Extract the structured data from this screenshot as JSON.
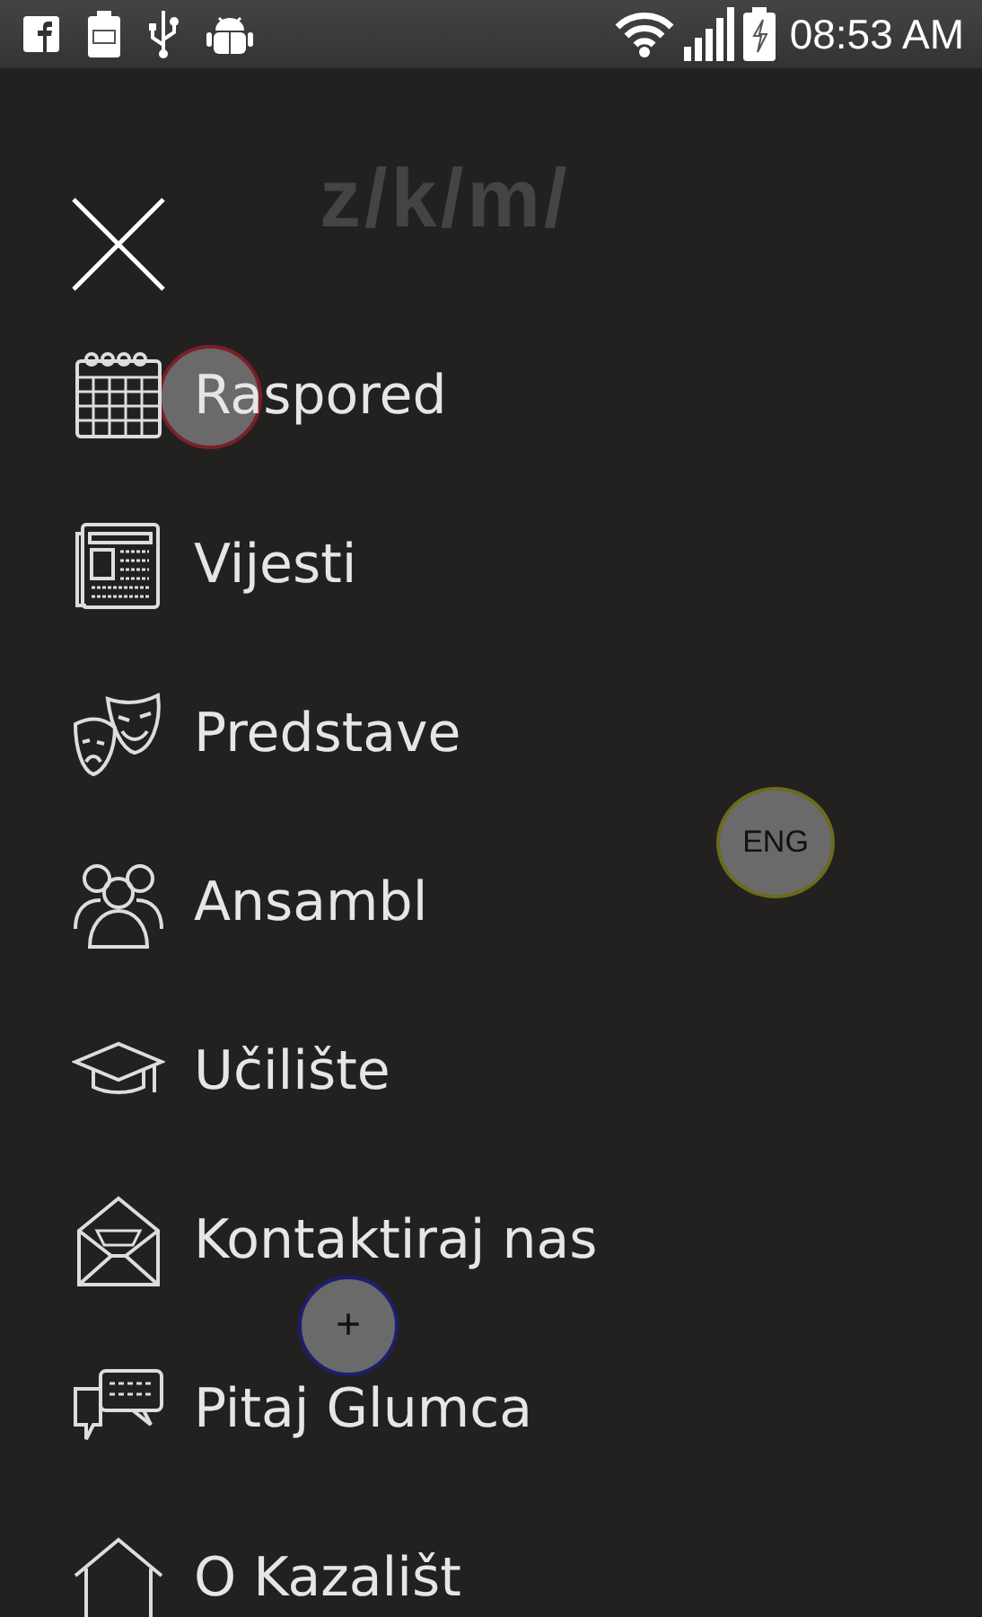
{
  "status_bar": {
    "time": "08:53 AM"
  },
  "logo": "z/k/m/",
  "menu_items": [
    {
      "label": "Raspored"
    },
    {
      "label": "Vijesti"
    },
    {
      "label": "Predstave"
    },
    {
      "label": "Ansambl"
    },
    {
      "label": "Učilište"
    },
    {
      "label": "Kontaktiraj nas"
    },
    {
      "label": "Pitaj Glumca"
    },
    {
      "label": "O Kazališt"
    }
  ],
  "floating": [
    {
      "color": "#7a2028"
    },
    {
      "label": "ENG",
      "color": "#6b6a1e"
    },
    {
      "label": "+",
      "color": "#1e1e6e"
    }
  ]
}
